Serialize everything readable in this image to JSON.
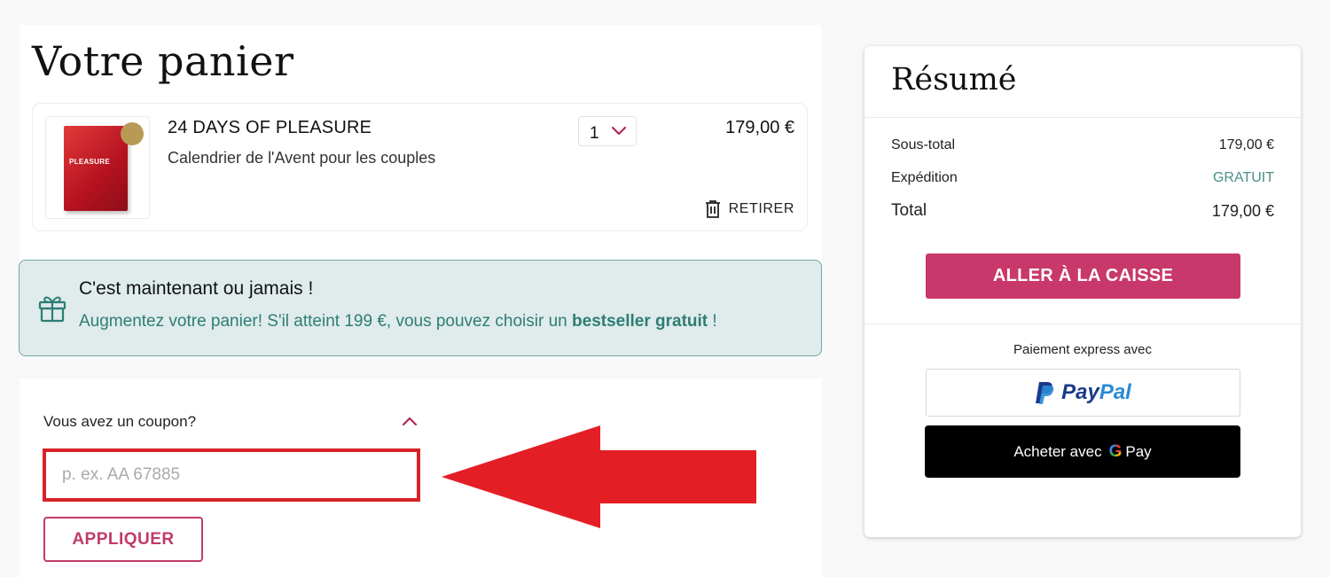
{
  "cart": {
    "title": "Votre panier",
    "item": {
      "name": "24 DAYS OF PLEASURE",
      "description": "Calendrier de l'Avent pour les couples",
      "quantity": "1",
      "price": "179,00 €",
      "remove_label": "RETIRER",
      "image_alt_text": "PLEASURE"
    }
  },
  "promo": {
    "title": "C'est maintenant ou jamais !",
    "text_before": "Augmentez votre panier! S'il atteint 199 €, vous pouvez choisir un ",
    "text_bold": "bestseller gratuit",
    "text_after": " !",
    "icon": "gift-icon"
  },
  "coupon": {
    "label": "Vous avez un coupon?",
    "placeholder": "p. ex. AA 67885",
    "value": "",
    "apply_label": "APPLIQUER"
  },
  "summary": {
    "title": "Résumé",
    "rows": [
      {
        "label": "Sous-total",
        "value": "179,00 €"
      },
      {
        "label": "Expédition",
        "value": "GRATUIT"
      },
      {
        "label": "Total",
        "value": "179,00 €"
      }
    ],
    "checkout_label": "ALLER À LA CAISSE",
    "express_label": "Paiement express avec",
    "paypal": {
      "pay": "Pay",
      "pal": "Pal"
    },
    "gpay": {
      "prefix": "Acheter avec",
      "g": "G",
      "pay": "Pay"
    }
  },
  "colors": {
    "brand": "#c9386b",
    "teal": "#2e7d74",
    "promo_bg": "#dfeceb",
    "annotation_red": "#e41e25"
  }
}
